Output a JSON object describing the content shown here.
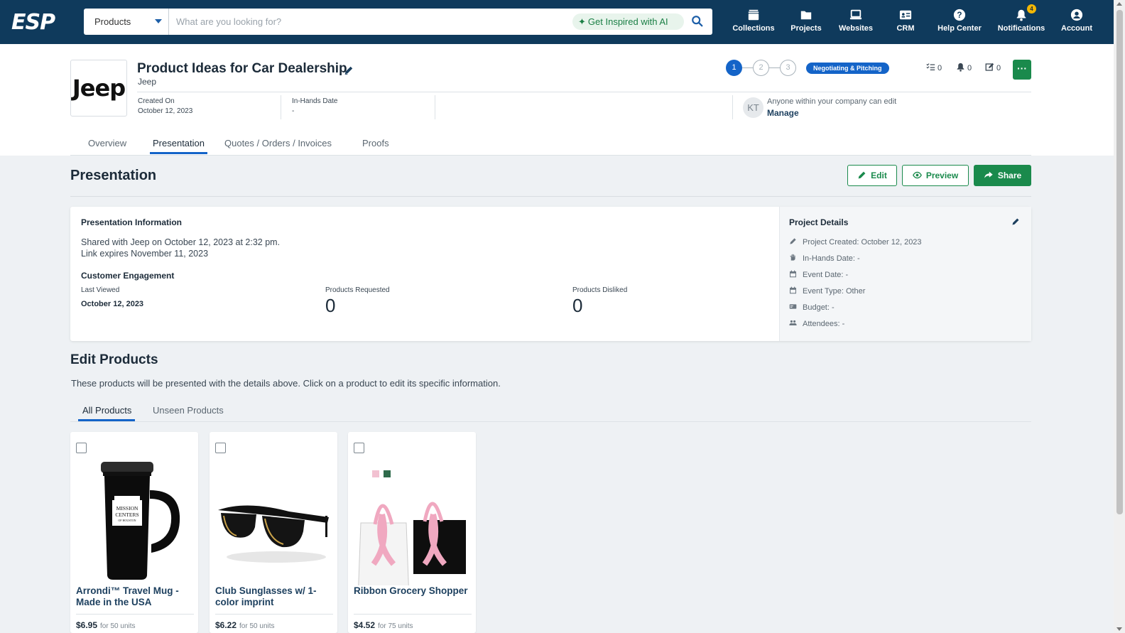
{
  "topbar": {
    "logo": "ESP",
    "search_scope": "Products",
    "search_placeholder": "What are you looking for?",
    "ai_label": "Get Inspired with AI",
    "nav": [
      {
        "label": "Collections",
        "icon": "collections-icon"
      },
      {
        "label": "Projects",
        "icon": "folder-icon"
      },
      {
        "label": "Websites",
        "icon": "laptop-icon"
      },
      {
        "label": "CRM",
        "icon": "contact-card-icon"
      },
      {
        "label": "Help Center",
        "icon": "help-icon"
      },
      {
        "label": "Notifications",
        "icon": "bell-icon",
        "badge": "4"
      },
      {
        "label": "Account",
        "icon": "user-circle-icon"
      }
    ]
  },
  "project": {
    "logo_text": "Jeep",
    "title": "Product Ideas for Car Dealership",
    "client": "Jeep",
    "created_label": "Created On",
    "created_value": "October 12, 2023",
    "inhands_label": "In-Hands Date",
    "inhands_value": "-",
    "steps": [
      "1",
      "2",
      "3"
    ],
    "active_step": 1,
    "status": "Negotiating & Pitching",
    "tasks_count": "0",
    "alerts_count": "0",
    "notes_count": "0",
    "avatar_initials": "KT",
    "edit_permission": "Anyone within your company can edit",
    "manage_label": "Manage",
    "tabs": [
      "Overview",
      "Presentation",
      "Quotes / Orders / Invoices",
      "Proofs"
    ],
    "active_tab": "Presentation"
  },
  "presentation": {
    "title": "Presentation",
    "edit_label": "Edit",
    "preview_label": "Preview",
    "share_label": "Share",
    "info_heading": "Presentation Information",
    "shared_text": "Shared with Jeep on October 12, 2023 at 2:32 pm.",
    "expires_text": "Link expires November 11, 2023",
    "engagement_heading": "Customer Engagement",
    "last_viewed_label": "Last Viewed",
    "last_viewed_value": "October 12, 2023",
    "requested_label": "Products Requested",
    "requested_value": "0",
    "disliked_label": "Products Disliked",
    "disliked_value": "0"
  },
  "project_details": {
    "heading": "Project Details",
    "rows": [
      {
        "icon": "pencil-icon",
        "text": "Project Created: October 12, 2023"
      },
      {
        "icon": "hand-icon",
        "text": "In-Hands Date: -"
      },
      {
        "icon": "calendar-icon",
        "text": "Event Date: -"
      },
      {
        "icon": "calendar-icon",
        "text": "Event Type: Other"
      },
      {
        "icon": "money-icon",
        "text": "Budget: -"
      },
      {
        "icon": "people-icon",
        "text": "Attendees: -"
      }
    ]
  },
  "edit_products": {
    "title": "Edit Products",
    "description": "These products will be presented with the details above. Click on a product to edit its specific information.",
    "tabs": [
      "All Products",
      "Unseen Products"
    ],
    "active_tab": "All Products",
    "products": [
      {
        "name": "Arrondi™ Travel Mug - Made in the USA",
        "price": "$6.95",
        "units": "for 50 units",
        "mug_print": [
          "MISSION",
          "CENTERS",
          "OF HOUSTON"
        ]
      },
      {
        "name": "Club Sunglasses w/ 1-color imprint",
        "price": "$6.22",
        "units": "for 50 units"
      },
      {
        "name": "Ribbon Grocery Shopper",
        "price": "$4.52",
        "units": "for 75 units"
      }
    ]
  },
  "colors": {
    "topbar": "#0f3a5c",
    "accent_blue": "#1464c8",
    "brand_green": "#1a8a4c",
    "badge": "#f2b705"
  }
}
